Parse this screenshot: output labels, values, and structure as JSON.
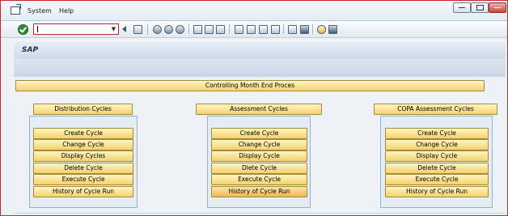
{
  "menu": {
    "items": [
      "System",
      "Help"
    ]
  },
  "toolbar": {
    "command_value": "",
    "icons": [
      "save-icon",
      "back-icon",
      "exit-icon",
      "cancel-icon",
      "print-icon",
      "find-icon",
      "find-next-icon",
      "first-page-icon",
      "previous-page-icon",
      "next-page-icon",
      "last-page-icon",
      "create-session-icon",
      "shortcut-icon",
      "help-icon",
      "customize-layout-icon"
    ]
  },
  "header": {
    "title": "SAP"
  },
  "main": {
    "section_title": "Controlling Month End Proces",
    "columns": [
      {
        "title": "Distribution Cycles",
        "buttons": [
          "Create Cycle",
          "Change Cycle",
          "Display Cycles",
          "Delete Cycle",
          "Execute Cycle",
          "History of Cycle Run"
        ]
      },
      {
        "title": "Assessment Cycles",
        "buttons": [
          "Create Cycle",
          "Change Cycle",
          "Display Cycle",
          "Dlete Cycle",
          "Execute Cycle",
          "History of Cycle Run"
        ]
      },
      {
        "title": "COPA Assessment Cycles",
        "buttons": [
          "Create Cycle",
          "Change Cycle",
          "Display Cycle",
          "Delete Cycle",
          "Execute Cycle",
          "History of Cycle Run"
        ]
      }
    ]
  }
}
